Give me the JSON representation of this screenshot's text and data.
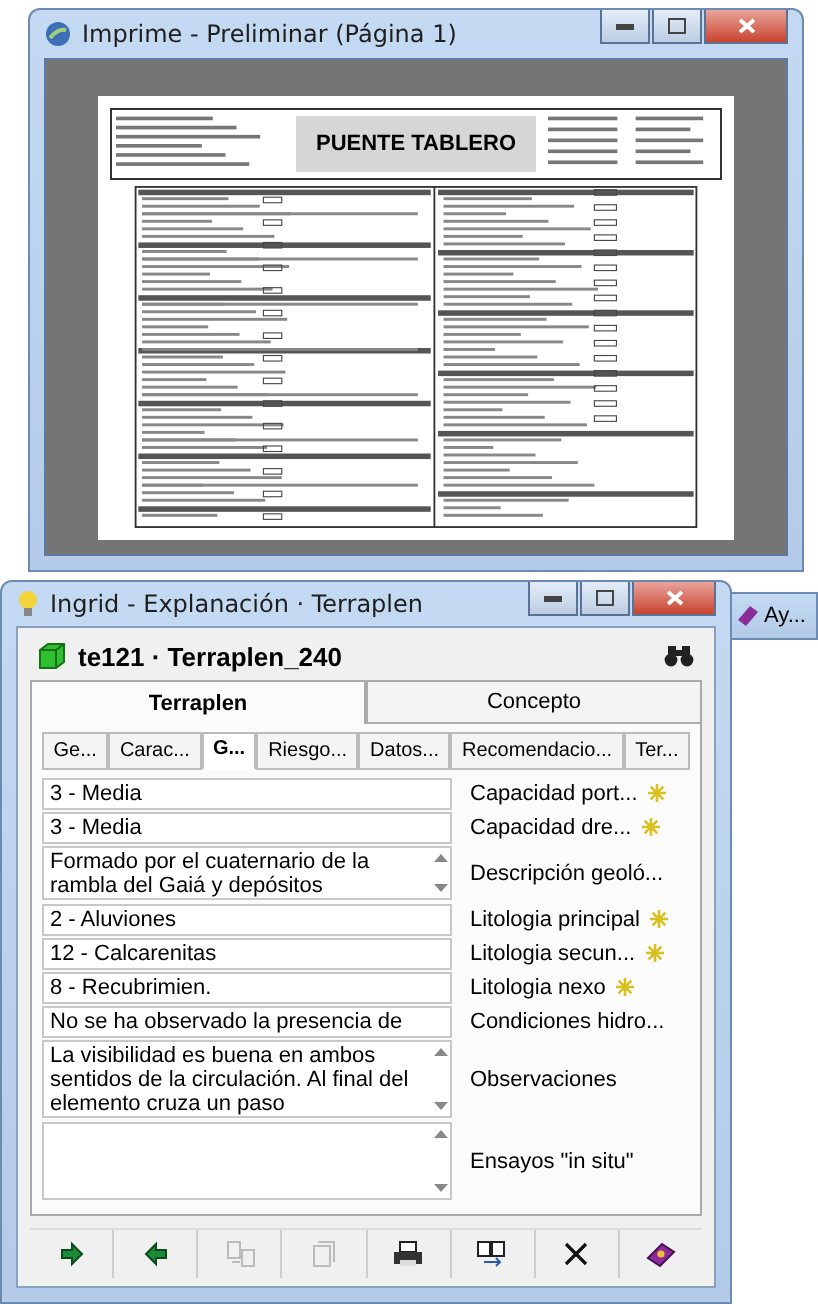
{
  "preview_window": {
    "title": "Imprime - Preliminar (Página 1)",
    "document": {
      "heading": "PUENTE TABLERO"
    }
  },
  "background_window": {
    "title": "Ay..."
  },
  "editor_window": {
    "title": "Ingrid - Explanación · Terraplen",
    "record": "te121 · Terraplen_240",
    "tabs": [
      {
        "label": "Terraplen",
        "selected": true
      },
      {
        "label": "Concepto",
        "selected": false
      }
    ],
    "subtabs": [
      {
        "label": "Ge...",
        "selected": false
      },
      {
        "label": "Carac...",
        "selected": false
      },
      {
        "label": "G...",
        "selected": true
      },
      {
        "label": "Riesgo...",
        "selected": false
      },
      {
        "label": "Datos...",
        "selected": false
      },
      {
        "label": "Recomendacio...",
        "selected": false
      },
      {
        "label": "Ter...",
        "selected": false
      }
    ],
    "fields": [
      {
        "kind": "line",
        "value": "3 - Media",
        "label": "Capacidad port...",
        "required": true
      },
      {
        "kind": "line",
        "value": "3 - Media",
        "label": "Capacidad dre...",
        "required": true
      },
      {
        "kind": "short-memo",
        "value": "Formado por el cuaternario de la rambla del Gaiá y depósitos",
        "label": "Descripción geoló...",
        "required": false
      },
      {
        "kind": "line",
        "value": "2 - Aluviones",
        "label": "Litologia principal",
        "required": true
      },
      {
        "kind": "line",
        "value": "12 - Calcarenitas",
        "label": "Litologia secun...",
        "required": true
      },
      {
        "kind": "line",
        "value": "8 - Recubrimien.",
        "label": "Litologia nexo",
        "required": true
      },
      {
        "kind": "line",
        "value": "No se ha observado la presencia de",
        "label": "Condiciones hidro...",
        "required": false
      },
      {
        "kind": "memo",
        "value": "La visibilidad es buena en ambos sentidos de la circulación.  Al final del elemento cruza un paso",
        "label": "Observaciones",
        "required": false
      },
      {
        "kind": "memo",
        "label": "Ensayos \"in situ\"",
        "required": false
      }
    ],
    "toolbar": [
      {
        "kind": "forward",
        "disabled": false
      },
      {
        "kind": "back",
        "disabled": false
      },
      {
        "kind": "transfer",
        "disabled": true
      },
      {
        "kind": "copy",
        "disabled": true
      },
      {
        "kind": "print",
        "disabled": false
      },
      {
        "kind": "pages",
        "disabled": false
      },
      {
        "kind": "delete",
        "disabled": false
      },
      {
        "kind": "help",
        "disabled": false
      }
    ]
  }
}
